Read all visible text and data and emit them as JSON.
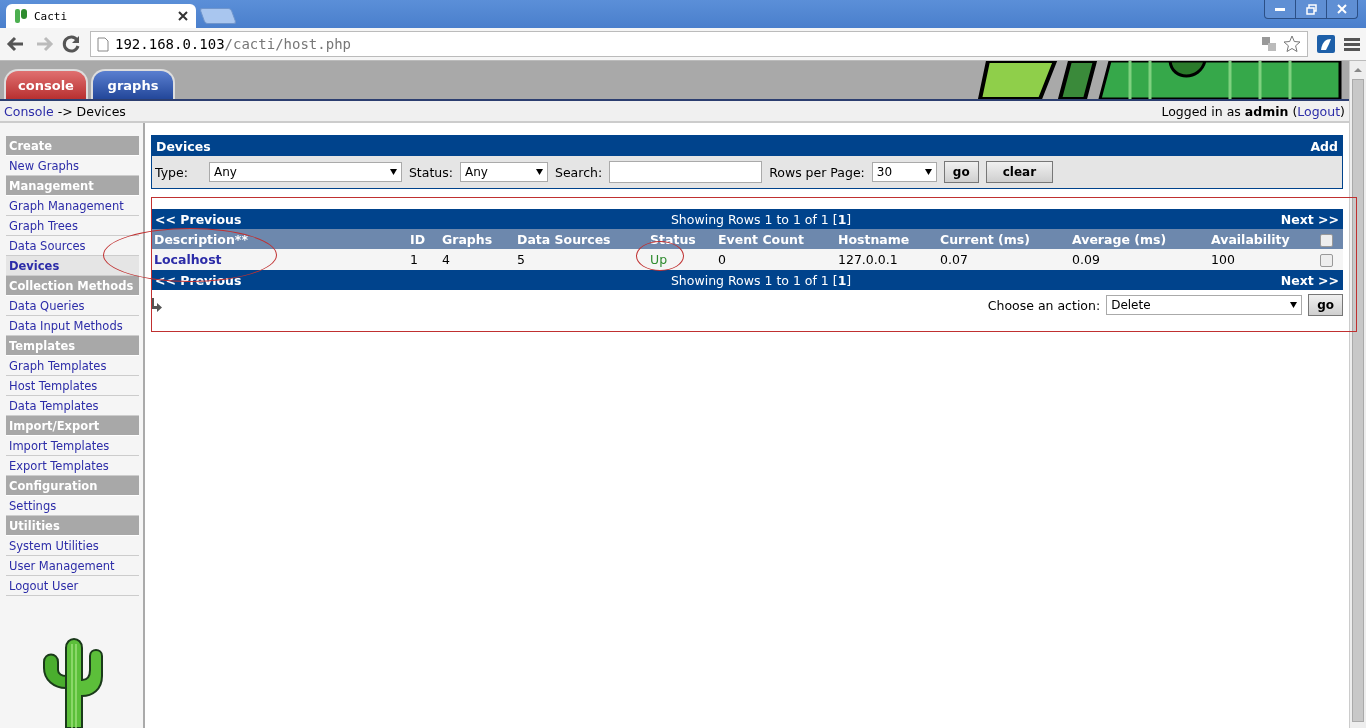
{
  "browser": {
    "tab_title": "Cacti",
    "url_host": "192.168.0.103",
    "url_path": "/cacti/host.php"
  },
  "header": {
    "tabs": [
      {
        "label": "console",
        "selected": true
      },
      {
        "label": "graphs",
        "selected": false
      }
    ]
  },
  "breadcrumb": {
    "link": "Console",
    "separator": "->",
    "current": "Devices"
  },
  "login": {
    "prefix": "Logged in as",
    "user": "admin",
    "open": "(",
    "logout": "Logout",
    "close": ")"
  },
  "sidebar": {
    "items": [
      {
        "label": "Create",
        "kind": "heading",
        "selected": false
      },
      {
        "label": "New Graphs",
        "kind": "link",
        "selected": false
      },
      {
        "label": "Management",
        "kind": "heading",
        "selected": false
      },
      {
        "label": "Graph Management",
        "kind": "link",
        "selected": false
      },
      {
        "label": "Graph Trees",
        "kind": "link",
        "selected": false
      },
      {
        "label": "Data Sources",
        "kind": "link",
        "selected": false
      },
      {
        "label": "Devices",
        "kind": "link",
        "selected": true
      },
      {
        "label": "Collection Methods",
        "kind": "heading",
        "selected": false
      },
      {
        "label": "Data Queries",
        "kind": "link",
        "selected": false
      },
      {
        "label": "Data Input Methods",
        "kind": "link",
        "selected": false
      },
      {
        "label": "Templates",
        "kind": "heading",
        "selected": false
      },
      {
        "label": "Graph Templates",
        "kind": "link",
        "selected": false
      },
      {
        "label": "Host Templates",
        "kind": "link",
        "selected": false
      },
      {
        "label": "Data Templates",
        "kind": "link",
        "selected": false
      },
      {
        "label": "Import/Export",
        "kind": "heading",
        "selected": false
      },
      {
        "label": "Import Templates",
        "kind": "link",
        "selected": false
      },
      {
        "label": "Export Templates",
        "kind": "link",
        "selected": false
      },
      {
        "label": "Configuration",
        "kind": "heading",
        "selected": false
      },
      {
        "label": "Settings",
        "kind": "link",
        "selected": false
      },
      {
        "label": "Utilities",
        "kind": "heading",
        "selected": false
      },
      {
        "label": "System Utilities",
        "kind": "link",
        "selected": false
      },
      {
        "label": "User Management",
        "kind": "link",
        "selected": false
      },
      {
        "label": "Logout User",
        "kind": "link",
        "selected": false
      }
    ]
  },
  "filter": {
    "title": "Devices",
    "add": "Add",
    "type_label": "Type:",
    "type_value": "Any",
    "status_label": "Status:",
    "status_value": "Any",
    "search_label": "Search:",
    "rows_label": "Rows per Page:",
    "rows_value": "30",
    "buttons": [
      "go",
      "clear"
    ]
  },
  "table": {
    "nav_top": {
      "previous": "<< Previous",
      "showing": "Showing Rows 1 to 1 of 1 [**1**]",
      "next": "Next >>"
    },
    "columns": [
      "Description**",
      "ID",
      "Graphs",
      "Data Sources",
      "Status",
      "Event Count",
      "Hostname",
      "Current (ms)",
      "Average (ms)",
      "Availability"
    ],
    "select_all_checked": false,
    "rows": [
      {
        "cells": [
          "Localhost",
          "1",
          "4",
          "5",
          "Up",
          "0",
          "127.0.0.1",
          "0.07",
          "0.09",
          "100"
        ],
        "color": "#2e8b2e",
        "checked": false
      }
    ],
    "nav_bottom": {
      "previous": "<< Previous",
      "showing": "Showing Rows 1 to 1 of 1 [**1**]",
      "next": "Next >>"
    }
  },
  "action": {
    "label": "Choose an action:",
    "value": "Delete",
    "button": "go"
  }
}
